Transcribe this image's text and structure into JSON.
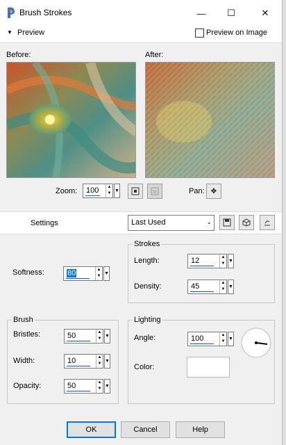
{
  "window": {
    "title": "Brush Strokes",
    "minimize": "—",
    "maximize": "☐",
    "close": "✕"
  },
  "preview_bar": {
    "label": "Preview",
    "preview_on_image": "Preview on Image"
  },
  "preview": {
    "before_label": "Before:",
    "after_label": "After:",
    "zoom_label": "Zoom:",
    "zoom_value": "100",
    "pan_label": "Pan:"
  },
  "settings_bar": {
    "label": "Settings",
    "preset_value": "Last Used"
  },
  "top_left": {
    "softness_label": "Softness:",
    "softness_value": "80"
  },
  "strokes": {
    "title": "Strokes",
    "length_label": "Length:",
    "length_value": "12",
    "density_label": "Density:",
    "density_value": "45"
  },
  "brush": {
    "title": "Brush",
    "bristles_label": "Bristles:",
    "bristles_value": "50",
    "width_label": "Width:",
    "width_value": "10",
    "opacity_label": "Opacity:",
    "opacity_value": "50"
  },
  "lighting": {
    "title": "Lighting",
    "angle_label": "Angle:",
    "angle_value": "100",
    "color_label": "Color:",
    "color_hex": "#ffffff"
  },
  "buttons": {
    "ok": "OK",
    "cancel": "Cancel",
    "help": "Help"
  }
}
